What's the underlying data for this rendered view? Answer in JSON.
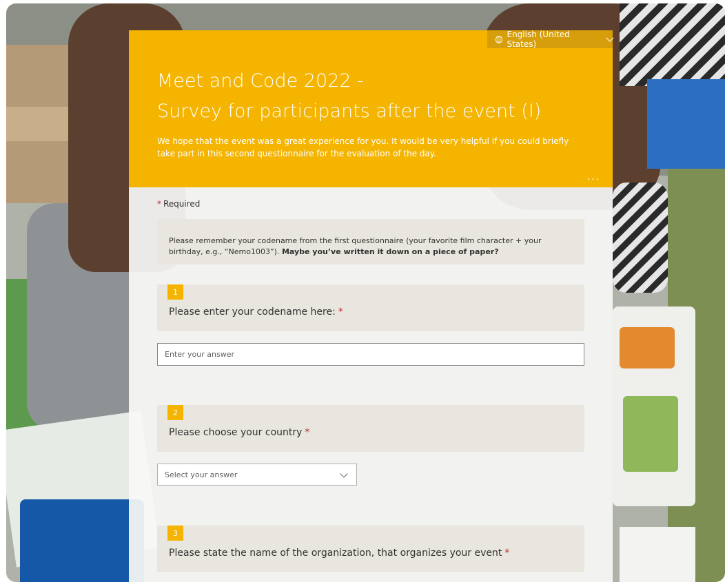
{
  "header": {
    "language": "English (United States)",
    "title_line1": "Meet and Code 2022 -",
    "title_line2": "Survey for participants after the event (I)",
    "description": "We hope that the event was a great experience for you. It would be very helpful if you could briefly take part in this second questionnaire for the evaluation of the day.",
    "more_label": "..."
  },
  "required_note": {
    "star": "*",
    "label": "Required"
  },
  "info": {
    "text": "Please remember your codename from the first questionnaire (your favorite film character + your birthday, e.g., “Nemo1003”).",
    "bold": "Maybe you’ve written it down on a piece of paper?"
  },
  "questions": [
    {
      "number": "1",
      "text": "Please enter your codename here:",
      "required_mark": "*",
      "placeholder": "Enter your answer"
    },
    {
      "number": "2",
      "text": "Please choose your country",
      "required_mark": "*",
      "placeholder": "Select your answer"
    },
    {
      "number": "3",
      "text": "Please state the name of the organization, that organizes your event",
      "required_mark": "*"
    }
  ],
  "colors": {
    "accent": "#f4b400",
    "required": "#c4262e"
  }
}
